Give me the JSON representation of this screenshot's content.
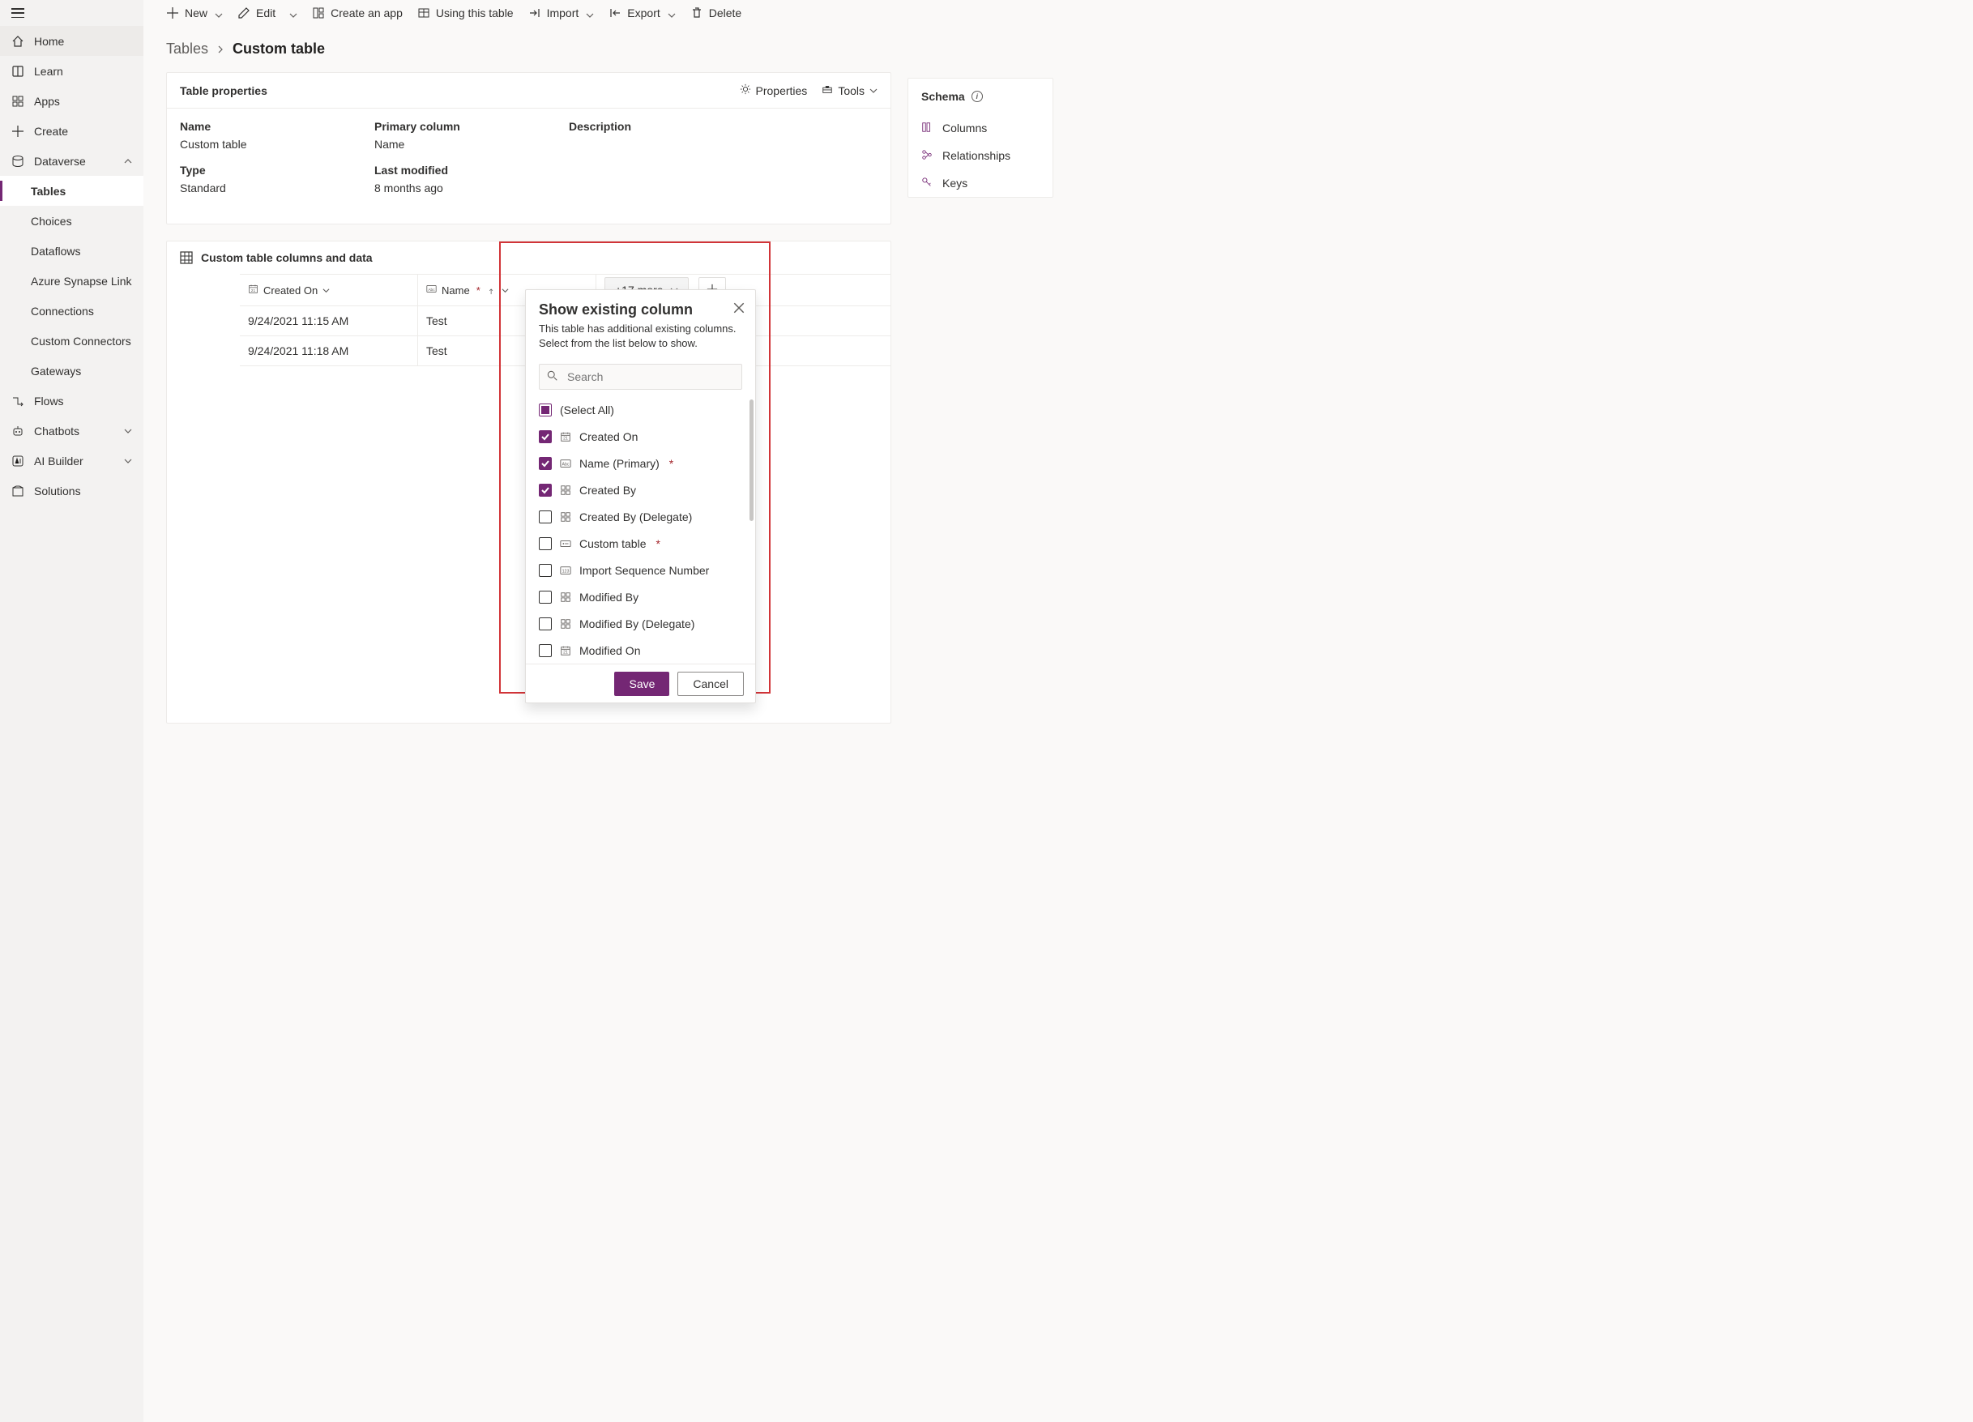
{
  "nav": {
    "home": "Home",
    "learn": "Learn",
    "apps": "Apps",
    "create": "Create",
    "dataverse": "Dataverse",
    "tables": "Tables",
    "choices": "Choices",
    "dataflows": "Dataflows",
    "azure_synapse": "Azure Synapse Link",
    "connections": "Connections",
    "custom_connectors": "Custom Connectors",
    "gateways": "Gateways",
    "flows": "Flows",
    "chatbots": "Chatbots",
    "ai_builder": "AI Builder",
    "solutions": "Solutions"
  },
  "cmdbar": {
    "new": "New",
    "edit": "Edit",
    "create_app": "Create an app",
    "using_table": "Using this table",
    "import": "Import",
    "export": "Export",
    "delete": "Delete"
  },
  "breadcrumb": {
    "tables": "Tables",
    "current": "Custom table"
  },
  "properties_card": {
    "title": "Table properties",
    "properties_link": "Properties",
    "tools_link": "Tools",
    "labels": {
      "name": "Name",
      "type": "Type",
      "primary_column": "Primary column",
      "last_modified": "Last modified",
      "description": "Description"
    },
    "values": {
      "name": "Custom table",
      "type": "Standard",
      "primary_column": "Name",
      "last_modified": "8 months ago",
      "description": ""
    }
  },
  "schema_card": {
    "title": "Schema",
    "columns": "Columns",
    "relationships": "Relationships",
    "keys": "Keys"
  },
  "grid": {
    "title": "Custom table columns and data",
    "headers": {
      "created_on": "Created On",
      "name": "Name"
    },
    "more": "+17 more",
    "rows": [
      {
        "created_on": "9/24/2021 11:15 AM",
        "name": "Test"
      },
      {
        "created_on": "9/24/2021 11:18 AM",
        "name": "Test"
      }
    ]
  },
  "popup": {
    "title": "Show existing column",
    "subtitle": "This table has additional existing columns. Select from the list below to show.",
    "search_placeholder": "Search",
    "select_all": "(Select All)",
    "items": [
      {
        "label": "Created On",
        "checked": true,
        "type": "date"
      },
      {
        "label": "Name (Primary)",
        "checked": true,
        "type": "text",
        "required": true
      },
      {
        "label": "Created By",
        "checked": true,
        "type": "lookup"
      },
      {
        "label": "Created By (Delegate)",
        "checked": false,
        "type": "lookup"
      },
      {
        "label": "Custom table",
        "checked": false,
        "type": "key",
        "required": true
      },
      {
        "label": "Import Sequence Number",
        "checked": false,
        "type": "number"
      },
      {
        "label": "Modified By",
        "checked": false,
        "type": "lookup"
      },
      {
        "label": "Modified By (Delegate)",
        "checked": false,
        "type": "lookup"
      },
      {
        "label": "Modified On",
        "checked": false,
        "type": "date"
      }
    ],
    "save": "Save",
    "cancel": "Cancel"
  }
}
